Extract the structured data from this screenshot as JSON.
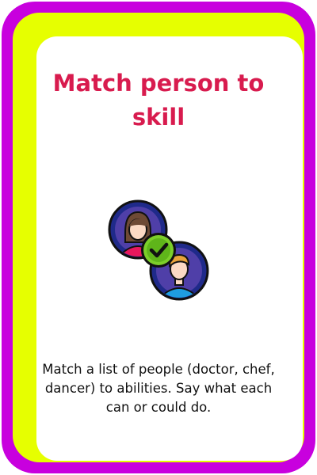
{
  "card": {
    "title": "Match person to skill",
    "description": "Match a list of people (doctor, chef, dancer) to abilities. Say what each can or could do.",
    "icon": "people-match-check-icon"
  },
  "colors": {
    "outer_border": "#c800de",
    "inner_border": "#e6ff00",
    "title": "#d81b4e",
    "text": "#111111"
  }
}
